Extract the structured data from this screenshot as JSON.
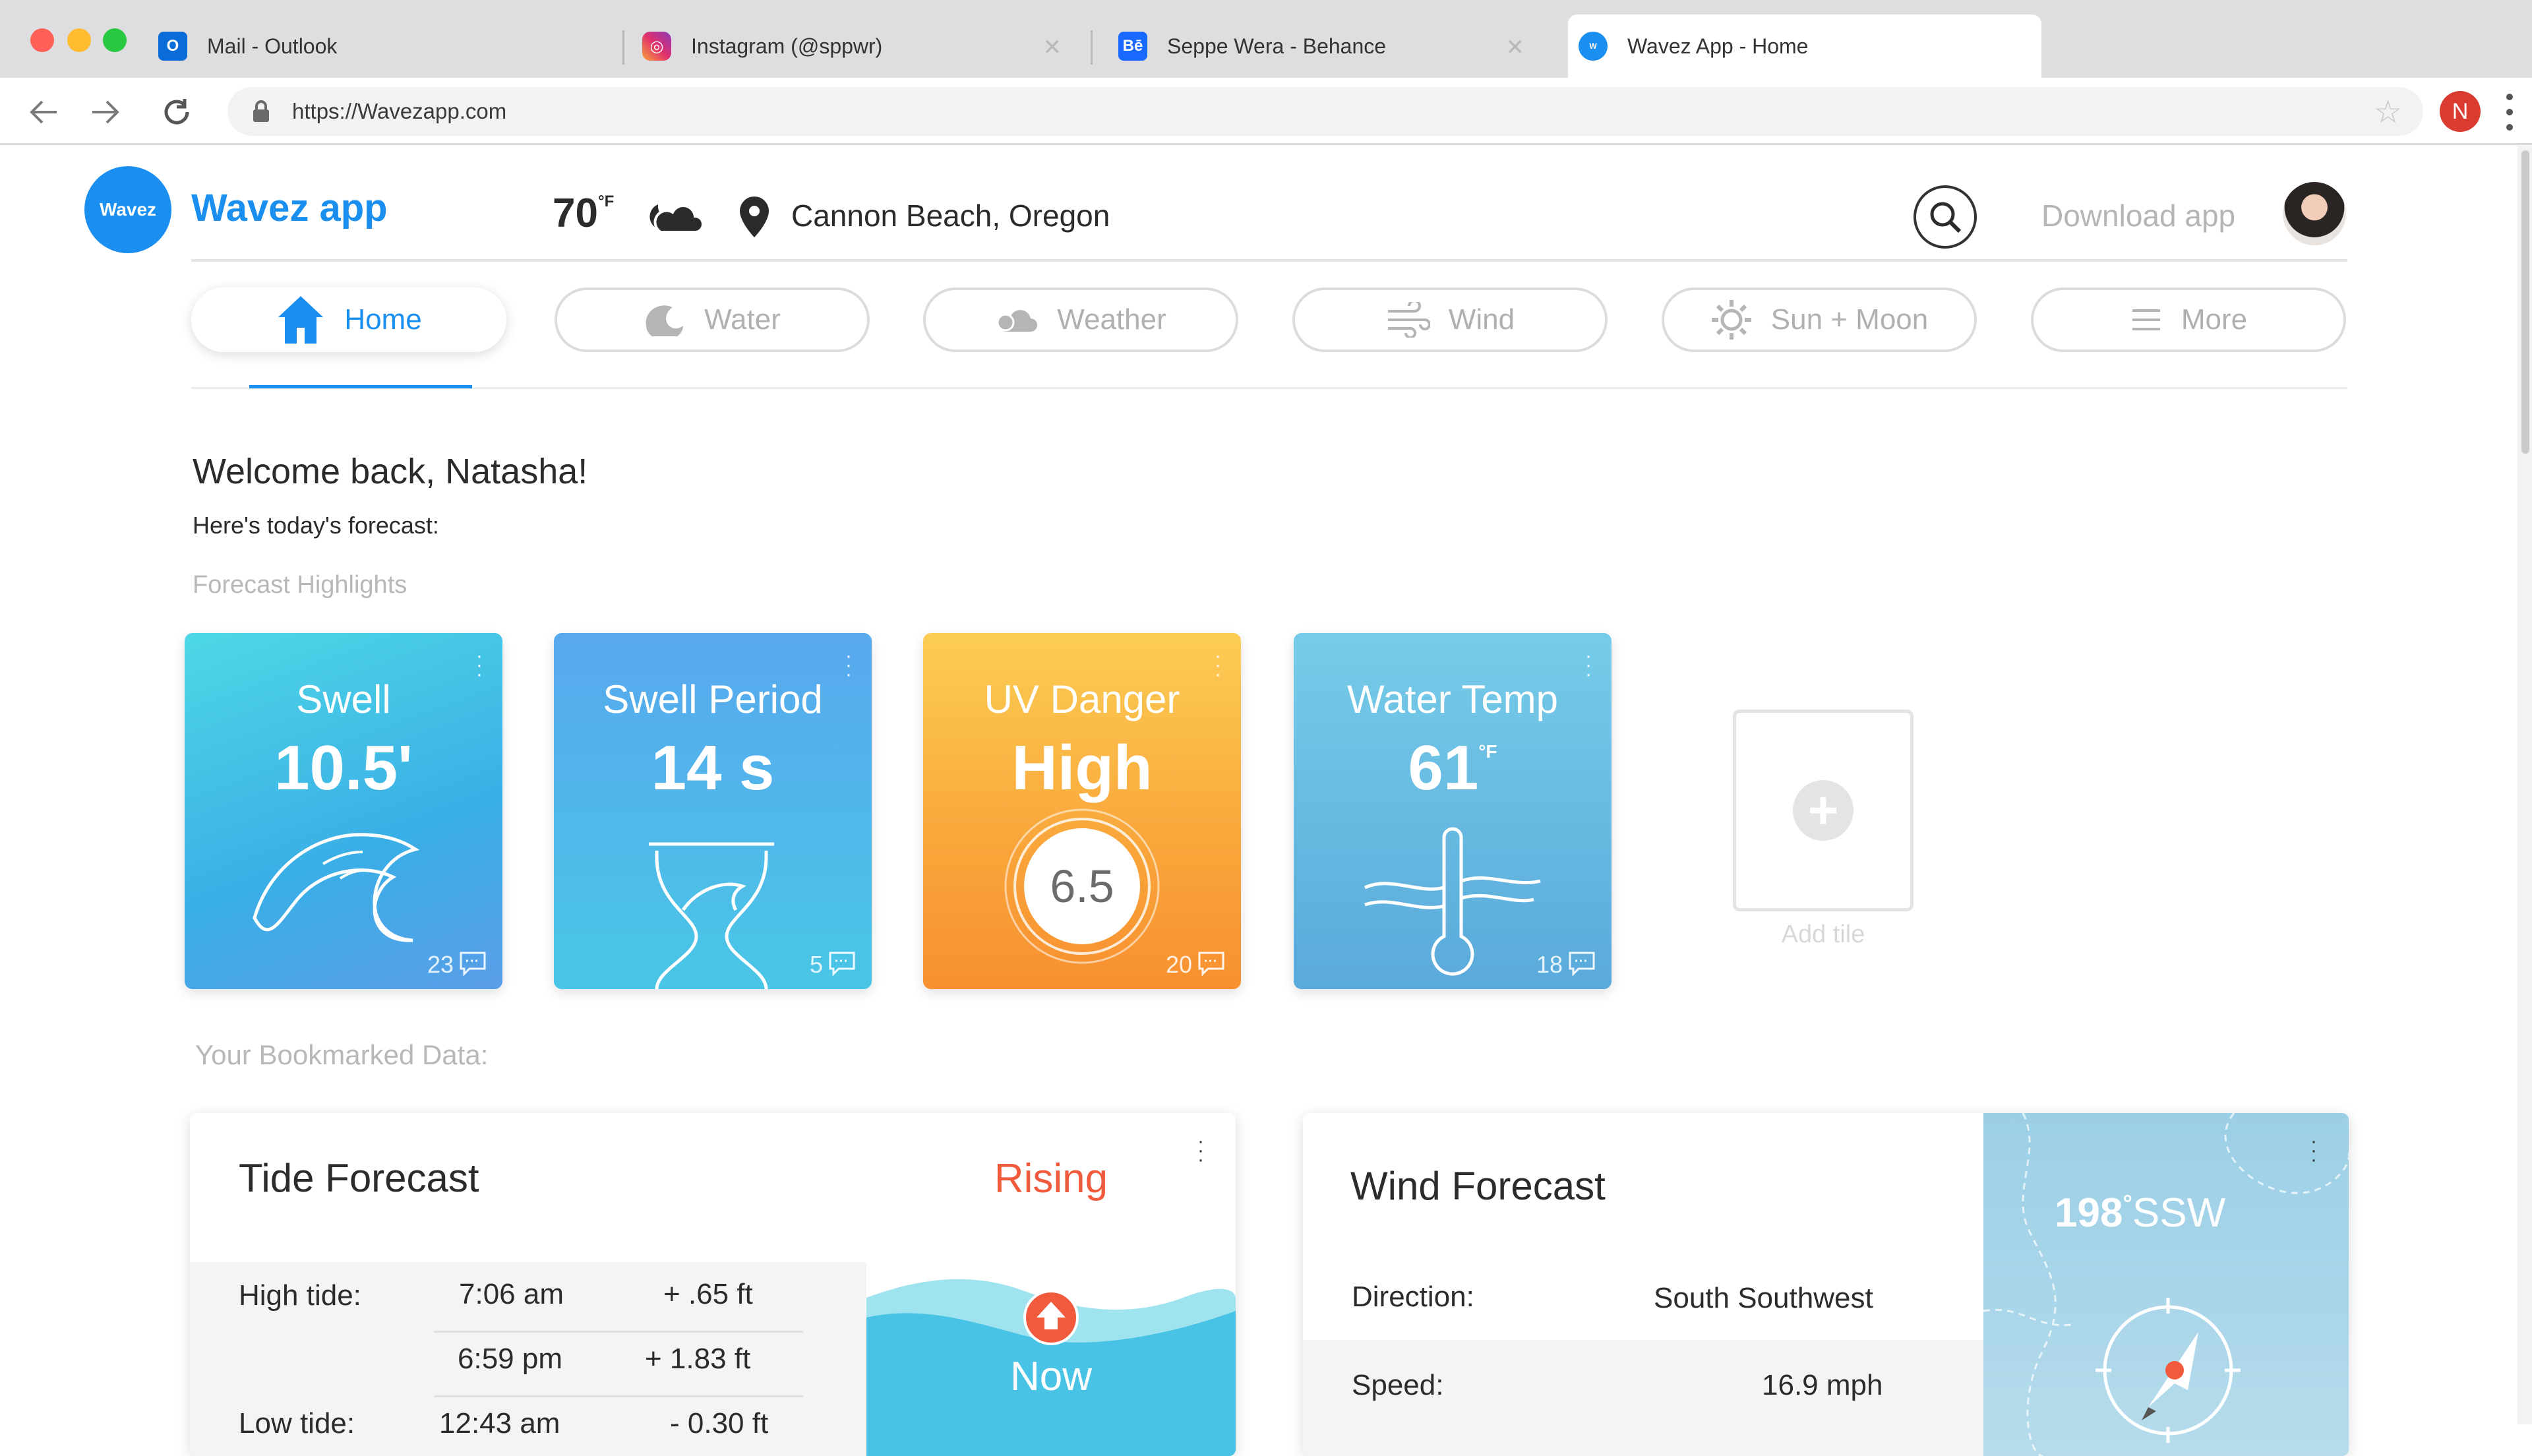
{
  "browser": {
    "tabs": [
      {
        "title": "Mail - Outlook",
        "icon": "outlook-icon"
      },
      {
        "title": "Instagram (@sppwr)",
        "icon": "instagram-icon"
      },
      {
        "title": "Seppe Wera - Behance",
        "icon": "behance-icon"
      },
      {
        "title": "Wavez App - Home",
        "icon": "wavez-icon"
      }
    ],
    "url": "https://Wavezapp.com",
    "profile_initial": "N"
  },
  "header": {
    "logo_badge": "Wavez",
    "app_name": "Wavez app",
    "temperature": "70",
    "temperature_unit": "°F",
    "location": "Cannon Beach, Oregon",
    "download_label": "Download app"
  },
  "nav": {
    "tabs": [
      {
        "label": "Home",
        "icon": "home-icon",
        "active": true
      },
      {
        "label": "Water",
        "icon": "water-icon"
      },
      {
        "label": "Weather",
        "icon": "cloud-icon"
      },
      {
        "label": "Wind",
        "icon": "wind-icon"
      },
      {
        "label": "Sun + Moon",
        "icon": "sun-icon"
      },
      {
        "label": "More",
        "icon": "menu-lines-icon"
      }
    ]
  },
  "welcome": {
    "greeting": "Welcome back, Natasha!",
    "subtitle": "Here's today's forecast:",
    "highlights_label": "Forecast Highlights"
  },
  "tiles": [
    {
      "title": "Swell",
      "value": "10.5'",
      "comments": "23",
      "icon": "wave-icon"
    },
    {
      "title": "Swell Period",
      "value": "14 s",
      "comments": "5",
      "icon": "hourglass-icon"
    },
    {
      "title": "UV Danger",
      "value": "High",
      "index": "6.5",
      "comments": "20",
      "icon": "uv-gauge-icon"
    },
    {
      "title": "Water Temp",
      "value": "61",
      "unit": "°F",
      "comments": "18",
      "icon": "thermometer-icon"
    }
  ],
  "add_tile_label": "Add tile",
  "bookmarked_label": "Your Bookmarked Data:",
  "tide": {
    "title": "Tide Forecast",
    "status": "Rising",
    "status_time": "Now",
    "high_label": "High tide:",
    "high": [
      {
        "time": "7:06 am",
        "height": "+ .65 ft"
      },
      {
        "time": "6:59 pm",
        "height": "+ 1.83 ft"
      }
    ],
    "low_label": "Low tide:",
    "low": [
      {
        "time": "12:43 am",
        "height": "- 0.30 ft"
      }
    ]
  },
  "wind": {
    "title": "Wind Forecast",
    "direction_label": "Direction:",
    "direction_value": "South Southwest",
    "speed_label": "Speed:",
    "speed_value": "16.9 mph",
    "compass_degrees": "198",
    "compass_unit": "°",
    "compass_dir": "SSW"
  },
  "colors": {
    "brand": "#1a8ff0",
    "rising": "#f15a3d"
  }
}
